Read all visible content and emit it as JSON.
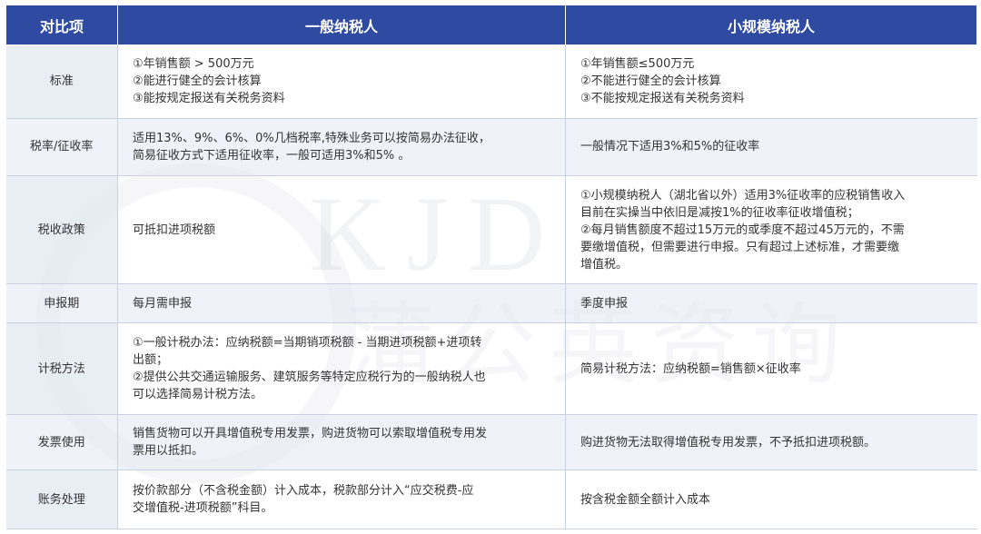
{
  "header": {
    "col_item": "对比项",
    "col_general": "一般纳税人",
    "col_small": "小规模纳税人"
  },
  "rows": [
    {
      "label": "标准",
      "general": [
        "①年销售额 > 500万元",
        "②能进行健全的会计核算",
        "③能按规定报送有关税务资料"
      ],
      "small": [
        "①年销售额≤500万元",
        "②不能进行健全的会计核算",
        "③不能按规定报送有关税务资料"
      ]
    },
    {
      "label": "税率/征收率",
      "general": [
        "适用13%、9%、6%、0%几档税率,特殊业务可以按简易办法征收，",
        "简易征收方式下适用征收率，一般可适用3%和5% 。"
      ],
      "small": [
        "一般情况下适用3%和5%的征收率"
      ]
    },
    {
      "label": "税收政策",
      "general": [
        "可抵扣进项税额"
      ],
      "small": [
        "①小规模纳税人（湖北省以外）适用3%征收率的应税销售收入",
        "目前在实操当中依旧是减按1%的征收率征收增值税；",
        "②每月销售额度不超过15万元的或季度不超过45万元的，不需",
        "要缴增值税，但需要进行申报。只有超过上述标准，才需要缴",
        "增值税。"
      ]
    },
    {
      "label": "申报期",
      "general": [
        "每月需申报"
      ],
      "small": [
        "季度申报"
      ]
    },
    {
      "label": "计税方法",
      "general": [
        "①一般计税办法：应纳税额=当期销项税额 - 当期进项税额+进项转",
        "出额；",
        "②提供公共交通运输服务、建筑服务等特定应税行为的一般纳税人也",
        "可以选择简易计税方法。"
      ],
      "small": [
        "简易计税方法：应纳税额=销售额×征收率"
      ]
    },
    {
      "label": "发票使用",
      "general": [
        "销售货物可以开具增值税专用发票，购进货物可以索取增值税专用发",
        "票用以抵扣。"
      ],
      "small": [
        "购进货物无法取得增值税专用发票，不予抵扣进项税额。"
      ]
    },
    {
      "label": "账务处理",
      "general": [
        "按价款部分（不含税金额）计入成本，税款部分计入“应交税费-应",
        "交增值税-进项税额”科目。"
      ],
      "small": [
        "按含税金额全额计入成本"
      ]
    }
  ],
  "watermark": {
    "letters": "KJD",
    "chinese": "蒲公英资询"
  }
}
